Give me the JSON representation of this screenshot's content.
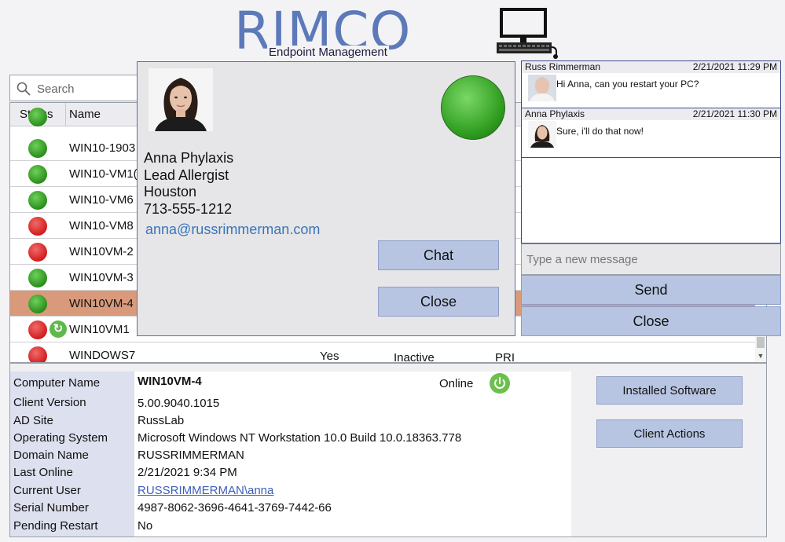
{
  "header": {
    "brand": "RIMCO",
    "subtitle": "Endpoint Management",
    "logo_icon": "desktop-computer-icon"
  },
  "search": {
    "placeholder": "Search",
    "icon": "search-icon"
  },
  "table": {
    "columns": [
      "Status",
      "Name"
    ],
    "rows": [
      {
        "status": "online",
        "name": "WIN10-1903"
      },
      {
        "status": "online",
        "name": "WIN10-VM1("
      },
      {
        "status": "online",
        "name": "WIN10-VM6"
      },
      {
        "status": "offline",
        "name": "WIN10-VM8"
      },
      {
        "status": "offline",
        "name": "WIN10VM-2"
      },
      {
        "status": "online",
        "name": "WIN10VM-3"
      },
      {
        "status": "online",
        "name": "WIN10VM-4",
        "selected": true
      },
      {
        "status": "offline",
        "name": "WIN10VM1",
        "pending_restart": true
      },
      {
        "status": "offline",
        "name": "WINDOWS7",
        "col3": "Yes",
        "col4": "Inactive",
        "col5": "PRI"
      }
    ]
  },
  "contact": {
    "name": "Anna Phylaxis",
    "title": "Lead Allergist",
    "city": "Houston",
    "phone": "713-555-1212",
    "email": "anna@russrimmerman.com",
    "chat_label": "Chat",
    "close_label": "Close",
    "presence_color": "#2e9c1e"
  },
  "chat": {
    "messages": [
      {
        "author": "Russ Rimmerman",
        "time": "2/21/2021 11:29 PM",
        "text": "Hi Anna, can you restart your PC?"
      },
      {
        "author": "Anna Phylaxis",
        "time": "2/21/2021 11:30 PM",
        "text": "Sure, i'll do that now!"
      }
    ],
    "input_placeholder": "Type a new message",
    "send_label": "Send",
    "close_label": "Close"
  },
  "details": {
    "labels": {
      "computer_name": "Computer Name",
      "client_version": "Client Version",
      "ad_site": "AD Site",
      "operating_system": "Operating System",
      "domain_name": "Domain Name",
      "last_online": "Last Online",
      "current_user": "Current User",
      "serial_number": "Serial Number",
      "pending_restart": "Pending Restart"
    },
    "values": {
      "computer_name": "WIN10VM-4",
      "client_version": "5.00.9040.1015",
      "ad_site": "RussLab",
      "operating_system": "Microsoft Windows NT Workstation 10.0 Build 10.0.18363.778",
      "domain_name": "RUSSRIMMERMAN",
      "last_online": "2/21/2021 9:34 PM",
      "current_user": "RUSSRIMMERMAN\\anna",
      "serial_number": "4987-8062-3696-4641-3769-7442-66",
      "pending_restart": "No"
    },
    "status_text": "Online",
    "installed_software_label": "Installed Software",
    "client_actions_label": "Client Actions"
  }
}
